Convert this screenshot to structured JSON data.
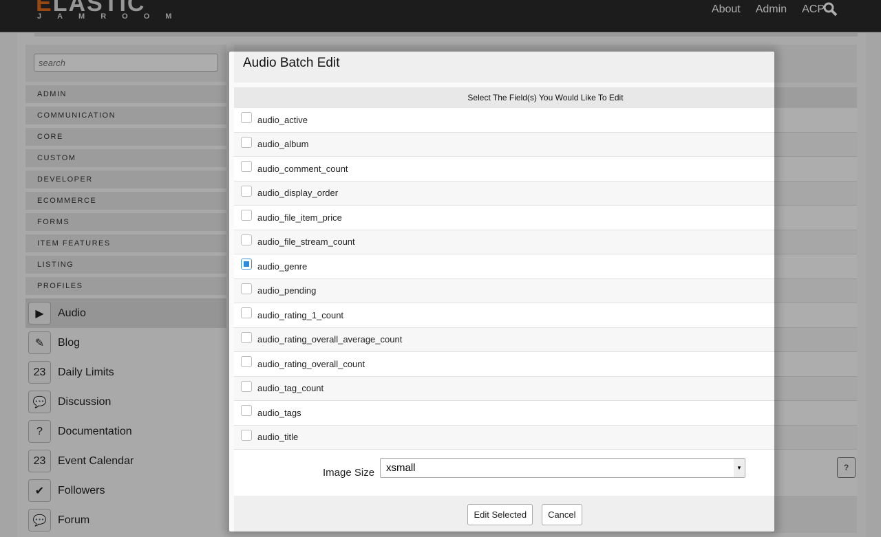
{
  "header": {
    "logo_main": "ELASTIC",
    "logo_sub": "JAMROOM",
    "nav": [
      "About",
      "Admin",
      "ACP"
    ]
  },
  "sidebar": {
    "search_placeholder": "search",
    "groups": [
      "ADMIN",
      "COMMUNICATION",
      "CORE",
      "CUSTOM",
      "DEVELOPER",
      "ECOMMERCE",
      "FORMS",
      "ITEM FEATURES",
      "LISTING",
      "PROFILES"
    ],
    "modules": [
      {
        "label": "Audio",
        "icon": "▶"
      },
      {
        "label": "Blog",
        "icon": "✎"
      },
      {
        "label": "Daily Limits",
        "icon": "23"
      },
      {
        "label": "Discussion",
        "icon": "💬"
      },
      {
        "label": "Documentation",
        "icon": "?"
      },
      {
        "label": "Event Calendar",
        "icon": "23"
      },
      {
        "label": "Followers",
        "icon": "✔"
      },
      {
        "label": "Forum",
        "icon": "💬"
      }
    ]
  },
  "main": {
    "title": "Audio Batch Edit",
    "fields_header": "Select The Field(s) You Would Like To Edit",
    "fields": [
      {
        "name": "audio_active",
        "checked": false
      },
      {
        "name": "audio_album",
        "checked": false
      },
      {
        "name": "audio_comment_count",
        "checked": false
      },
      {
        "name": "audio_display_order",
        "checked": false
      },
      {
        "name": "audio_file_item_price",
        "checked": false
      },
      {
        "name": "audio_file_stream_count",
        "checked": false
      },
      {
        "name": "audio_genre",
        "checked": true
      },
      {
        "name": "audio_pending",
        "checked": false
      },
      {
        "name": "audio_rating_1_count",
        "checked": false
      },
      {
        "name": "audio_rating_overall_average_count",
        "checked": false
      },
      {
        "name": "audio_rating_overall_count",
        "checked": false
      },
      {
        "name": "audio_tag_count",
        "checked": false
      },
      {
        "name": "audio_tags",
        "checked": false
      },
      {
        "name": "audio_title",
        "checked": false
      }
    ],
    "image_size_label": "Image Size",
    "image_size_value": "xsmall",
    "help": "?",
    "edit_button": "Edit Selected",
    "cancel_button": "Cancel"
  }
}
